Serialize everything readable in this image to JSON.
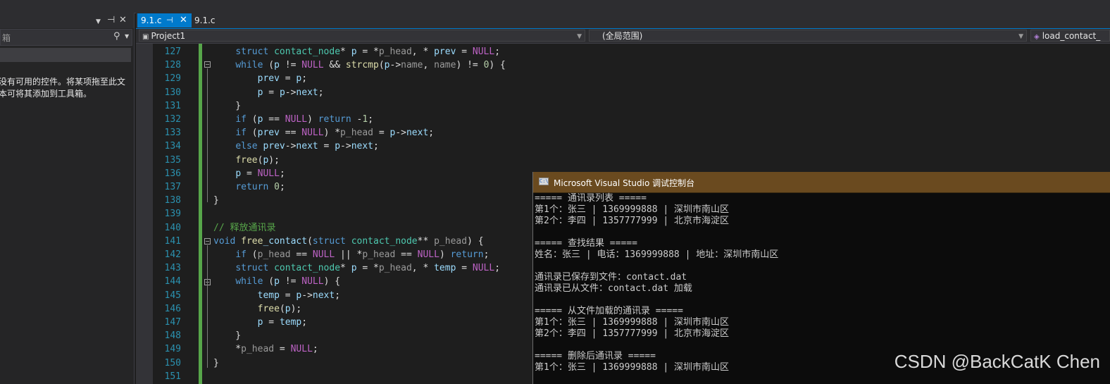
{
  "toolbox": {
    "title_fragment": "",
    "pin_icon": "pin-icon",
    "close_icon": "close-icon",
    "search_placeholder": "箱",
    "empty_message": "没有可用的控件。将某项拖至此文\n本可将其添加到工具箱。"
  },
  "tabs": [
    {
      "label": "9.1.c",
      "active": true
    },
    {
      "label": "9.1.c",
      "active": false
    }
  ],
  "navbar": {
    "project": "Project1",
    "scope": "(全局范围)",
    "member": "load_contact_"
  },
  "editor": {
    "lines": [
      {
        "num": "127",
        "text": "    struct contact_node* p = *p_head, * prev = NULL;"
      },
      {
        "num": "128",
        "text": "    while (p != NULL && strcmp(p->name, name) != 0) {"
      },
      {
        "num": "129",
        "text": "        prev = p;"
      },
      {
        "num": "130",
        "text": "        p = p->next;"
      },
      {
        "num": "131",
        "text": "    }"
      },
      {
        "num": "132",
        "text": "    if (p == NULL) return -1;"
      },
      {
        "num": "133",
        "text": "    if (prev == NULL) *p_head = p->next;"
      },
      {
        "num": "134",
        "text": "    else prev->next = p->next;"
      },
      {
        "num": "135",
        "text": "    free(p);"
      },
      {
        "num": "136",
        "text": "    p = NULL;"
      },
      {
        "num": "137",
        "text": "    return 0;"
      },
      {
        "num": "138",
        "text": "}"
      },
      {
        "num": "139",
        "text": ""
      },
      {
        "num": "140",
        "text": "// 释放通讯录"
      },
      {
        "num": "141",
        "text": "void free_contact(struct contact_node** p_head) {"
      },
      {
        "num": "142",
        "text": "    if (p_head == NULL || *p_head == NULL) return;"
      },
      {
        "num": "143",
        "text": "    struct contact_node* p = *p_head, * temp = NULL;"
      },
      {
        "num": "144",
        "text": "    while (p != NULL) {"
      },
      {
        "num": "145",
        "text": "        temp = p->next;"
      },
      {
        "num": "146",
        "text": "        free(p);"
      },
      {
        "num": "147",
        "text": "        p = temp;"
      },
      {
        "num": "148",
        "text": "    }"
      },
      {
        "num": "149",
        "text": "    *p_head = NULL;"
      },
      {
        "num": "150",
        "text": "}"
      },
      {
        "num": "151",
        "text": ""
      }
    ]
  },
  "console": {
    "title": "Microsoft Visual Studio 调试控制台",
    "icon_text": "C:\\",
    "lines": [
      "===== 通讯录列表 =====",
      "第1个：张三 | 1369999888 | 深圳市南山区",
      "第2个：李四 | 1357777999 | 北京市海淀区",
      "",
      "===== 查找结果 =====",
      "姓名：张三 | 电话：1369999888 | 地址：深圳市南山区",
      "",
      "通讯录已保存到文件：contact.dat",
      "通讯录已从文件：contact.dat 加载",
      "",
      "===== 从文件加载的通讯录 =====",
      "第1个：张三 | 1369999888 | 深圳市南山区",
      "第2个：李四 | 1357777999 | 北京市海淀区",
      "",
      "===== 删除后通讯录 =====",
      "第1个：张三 | 1369999888 | 深圳市南山区"
    ]
  },
  "watermark": "CSDN @BackCatK Chen",
  "colors": {
    "accent": "#007acc",
    "console_title": "#6a4a1f",
    "change_bar": "#57a64a",
    "line_number": "#2b91af"
  }
}
